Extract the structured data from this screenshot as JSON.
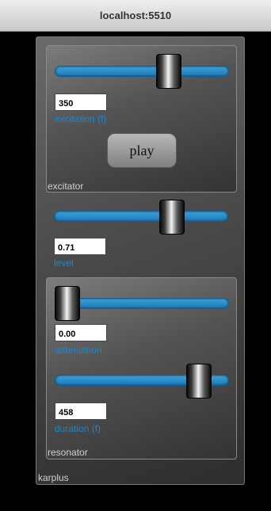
{
  "window": {
    "title": "localhost:5510"
  },
  "app": {
    "label": "karplus"
  },
  "excitator": {
    "label": "excitator",
    "excitation": {
      "value": "350",
      "caption": "excitation (f)"
    },
    "play_label": "play"
  },
  "level": {
    "value": "0.71",
    "caption": "level"
  },
  "resonator": {
    "label": "resonator",
    "attenuation": {
      "value": "0.00",
      "caption": "attenuation"
    },
    "duration": {
      "value": "458",
      "caption": "duration (f)"
    }
  },
  "colors": {
    "slider_track": "#2a8fd0",
    "caption_text": "#1f86c8",
    "panel_bg": "#4a4a4a",
    "page_bg": "#000000"
  }
}
